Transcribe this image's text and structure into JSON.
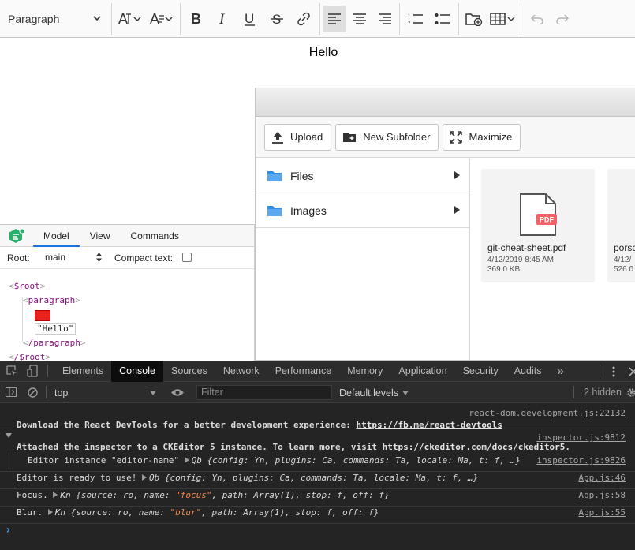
{
  "editor": {
    "toolbar": {
      "heading_select": "Paragraph"
    },
    "content_text": "Hello"
  },
  "file_manager": {
    "toolbar": {
      "upload": "Upload",
      "new_subfolder": "New Subfolder",
      "maximize": "Maximize"
    },
    "folders": [
      {
        "label": "Files",
        "icon": "folder-icon"
      },
      {
        "label": "Images",
        "icon": "folder-icon"
      }
    ],
    "files": [
      {
        "name": "git-cheat-sheet.pdf",
        "badge": "PDF",
        "date": "4/12/2019 8:45 AM",
        "size": "369.0 KB"
      },
      {
        "name": "porsc",
        "date": "4/12/",
        "size": "526.0"
      }
    ]
  },
  "inspector": {
    "tabs": [
      "Model",
      "View",
      "Commands"
    ],
    "active_tab": "Model",
    "root_label": "Root:",
    "root_value": "main",
    "compact_label": "Compact text:",
    "tree": {
      "root_open": "$root",
      "paragraph_open": "paragraph",
      "text": "\"Hello\"",
      "paragraph_close": "/paragraph",
      "root_close": "/$root"
    }
  },
  "devtools": {
    "tabs": [
      "Elements",
      "Console",
      "Sources",
      "Network",
      "Performance",
      "Memory",
      "Application",
      "Security",
      "Audits"
    ],
    "active_tab": "Console",
    "more_tabs": "»",
    "context": "top",
    "filter_placeholder": "Filter",
    "levels": "Default levels",
    "hidden": "2 hidden",
    "logs": [
      {
        "source": "react-dom.development.js:22132",
        "text": "Download the React DevTools for a better development experience: ",
        "link": "https://fb.me/react-devtools"
      },
      {
        "source": "inspector.js:9812",
        "text": "Attached the inspector to a CKEditor 5 instance. To learn more, visit ",
        "link": "https://ckeditor.com/docs/ckeditor5",
        "suffix": "."
      },
      {
        "source": "inspector.js:9826",
        "prefix": "Editor instance \"editor-name\" ",
        "obj_name": "Qb",
        "obj": "{config: Yn, plugins: Ca, commands: Ta, locale: Ma, t: f, …}"
      },
      {
        "source": "App.js:46",
        "prefix": "Editor is ready to use! ",
        "obj_name": "Qb",
        "obj": "{config: Yn, plugins: Ca, commands: Ta, locale: Ma, t: f, …}"
      },
      {
        "source": "App.js:58",
        "prefix": "Focus. ",
        "obj_name": "Kn",
        "obj_a": "{source: ro, name: ",
        "str": "\"focus\"",
        "obj_b": ", path: Array(1), stop: f, off: f}"
      },
      {
        "source": "App.js:55",
        "prefix": "Blur. ",
        "obj_name": "Kn",
        "obj_a": "{source: ro, name: ",
        "str": "\"blur\"",
        "obj_b": ", path: Array(1), stop: f, off: f}"
      }
    ],
    "prompt": "›"
  },
  "colors": {
    "devtools_bg": "#242424",
    "console_link": "#e4e4e4",
    "string": "#f28b54",
    "pdf_badge": "#f26165",
    "folder": "#2f8fe8",
    "inspector_logo": "#27b06b"
  }
}
